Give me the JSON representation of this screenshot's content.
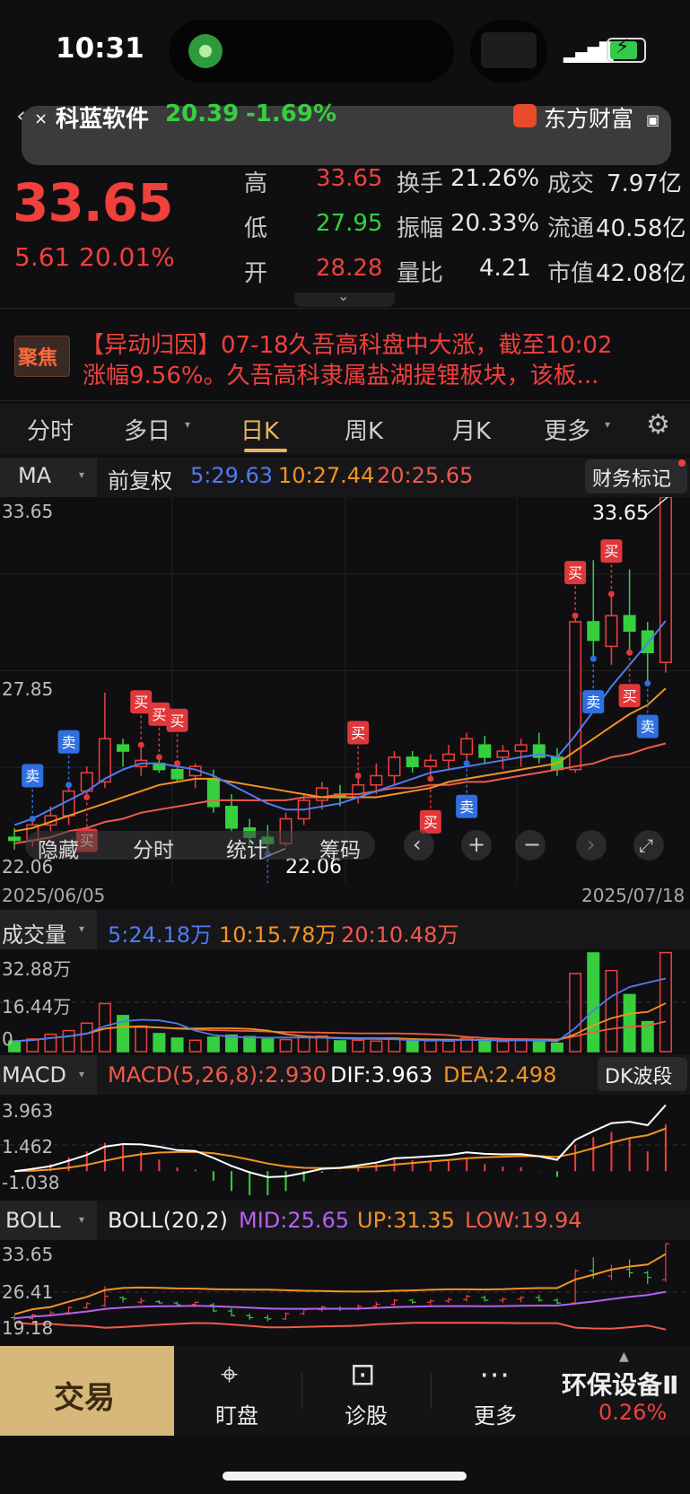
{
  "status_bar": {
    "time": "10:31"
  },
  "banner": {
    "close": "×",
    "name": "科蓝软件",
    "price": "20.39",
    "change": "-1.69%",
    "brand": "东方财富"
  },
  "quote": {
    "price": "33.65",
    "change": "5.61",
    "change_pct": "20.01%",
    "high_label": "高",
    "high": "33.65",
    "low_label": "低",
    "low": "27.95",
    "open_label": "开",
    "open": "28.28",
    "turnover_label": "换手",
    "turnover": "21.26%",
    "amplitude_label": "振幅",
    "amplitude": "20.33%",
    "vol_ratio_label": "量比",
    "vol_ratio": "4.21",
    "amount_label": "成交",
    "amount": "7.97亿",
    "float_label": "流通",
    "float_cap": "40.58亿",
    "mcap_label": "市值",
    "mcap": "42.08亿"
  },
  "focus": {
    "badge": "聚焦",
    "line1": "【异动归因】07-18久吾高科盘中大涨，截至10:02",
    "line2": "涨幅9.56%。久吾高科隶属盐湖提锂板块，该板..."
  },
  "tabs": [
    {
      "label": "分时"
    },
    {
      "label": "多日"
    },
    {
      "label": "日K"
    },
    {
      "label": "周K"
    },
    {
      "label": "月K"
    },
    {
      "label": "更多"
    }
  ],
  "indicator_row": {
    "ma_chip": "MA",
    "adjust": "前复权",
    "ma5": "5:29.63",
    "ma10": "10:27.44",
    "ma20": "20:25.65",
    "finance_btn": "财务标记"
  },
  "kline": {
    "y_top": "33.65",
    "y_mid": "27.85",
    "y_bot": "22.06",
    "max_label": "33.65",
    "min_label": "22.06",
    "date_start": "2025/06/05",
    "date_end": "2025/07/18",
    "signals": {
      "buy": "买",
      "sell": "卖"
    }
  },
  "chart_toolbar": {
    "hide": "隐藏",
    "intraday": "分时",
    "stats": "统计",
    "chips": "筹码"
  },
  "volume_panel": {
    "chip": "成交量",
    "v5": "5:24.18万",
    "v10": "10:15.78万",
    "v20": "20:10.48万",
    "y_top": "32.88万",
    "y_mid": "16.44万",
    "y_bot": "0"
  },
  "macd_panel": {
    "chip": "MACD",
    "macd": "MACD(5,26,8):2.930",
    "dif": "DIF:3.963",
    "dea": "DEA:2.498",
    "btn": "DK波段",
    "y_top": "3.963",
    "y_mid": "1.462",
    "y_bot": "-1.038"
  },
  "boll_panel": {
    "chip": "BOLL",
    "boll": "BOLL(20,2)",
    "mid": "MID:25.65",
    "up": "UP:31.35",
    "low": "LOW:19.94",
    "y_top": "33.65",
    "y_mid": "26.41",
    "y_bot": "19.18"
  },
  "bottom_nav": {
    "trade": "交易",
    "watch": "盯盘",
    "diagnose": "诊股",
    "more": "更多",
    "sector": "环保设备Ⅱ",
    "sector_change": "0.26%"
  },
  "colors": {
    "up": "#f0403c",
    "down": "#36d03e",
    "accent": "#e8b659",
    "ma5": "#4f7cf0",
    "ma10": "#f39322",
    "ma20": "#f05a4a"
  },
  "chart_data": {
    "type": "candlestick",
    "candles": [
      {
        "o": 22.6,
        "h": 22.9,
        "l": 22.2,
        "c": 22.5
      },
      {
        "o": 22.5,
        "h": 23.2,
        "l": 22.3,
        "c": 23.0
      },
      {
        "o": 23.0,
        "h": 23.6,
        "l": 22.8,
        "c": 23.3
      },
      {
        "o": 23.3,
        "h": 24.3,
        "l": 23.0,
        "c": 24.1
      },
      {
        "o": 24.1,
        "h": 24.9,
        "l": 23.9,
        "c": 24.7
      },
      {
        "o": 24.4,
        "h": 27.3,
        "l": 24.2,
        "c": 25.8
      },
      {
        "o": 25.6,
        "h": 25.8,
        "l": 24.9,
        "c": 25.4
      },
      {
        "o": 24.9,
        "h": 25.6,
        "l": 24.6,
        "c": 25.1
      },
      {
        "o": 25.0,
        "h": 25.2,
        "l": 24.7,
        "c": 24.8
      },
      {
        "o": 24.8,
        "h": 25.0,
        "l": 24.4,
        "c": 24.5
      },
      {
        "o": 24.6,
        "h": 25.0,
        "l": 24.2,
        "c": 24.9
      },
      {
        "o": 24.5,
        "h": 24.8,
        "l": 23.4,
        "c": 23.6
      },
      {
        "o": 23.6,
        "h": 24.0,
        "l": 22.8,
        "c": 22.9
      },
      {
        "o": 22.9,
        "h": 23.2,
        "l": 22.3,
        "c": 22.6
      },
      {
        "o": 22.6,
        "h": 23.0,
        "l": 22.06,
        "c": 22.4
      },
      {
        "o": 22.4,
        "h": 23.4,
        "l": 22.3,
        "c": 23.2
      },
      {
        "o": 23.2,
        "h": 24.0,
        "l": 23.0,
        "c": 23.8
      },
      {
        "o": 23.8,
        "h": 24.4,
        "l": 23.5,
        "c": 24.2
      },
      {
        "o": 24.0,
        "h": 24.3,
        "l": 23.6,
        "c": 23.9
      },
      {
        "o": 23.9,
        "h": 24.6,
        "l": 23.7,
        "c": 24.3
      },
      {
        "o": 24.3,
        "h": 25.0,
        "l": 24.0,
        "c": 24.6
      },
      {
        "o": 24.6,
        "h": 25.4,
        "l": 24.3,
        "c": 25.2
      },
      {
        "o": 25.2,
        "h": 25.4,
        "l": 24.7,
        "c": 24.9
      },
      {
        "o": 24.9,
        "h": 25.3,
        "l": 24.5,
        "c": 25.1
      },
      {
        "o": 25.1,
        "h": 25.6,
        "l": 24.8,
        "c": 25.3
      },
      {
        "o": 25.3,
        "h": 26.0,
        "l": 25.0,
        "c": 25.8
      },
      {
        "o": 25.6,
        "h": 25.9,
        "l": 25.0,
        "c": 25.2
      },
      {
        "o": 25.2,
        "h": 25.6,
        "l": 24.8,
        "c": 25.4
      },
      {
        "o": 25.4,
        "h": 25.8,
        "l": 24.9,
        "c": 25.6
      },
      {
        "o": 25.6,
        "h": 26.0,
        "l": 25.0,
        "c": 25.2
      },
      {
        "o": 25.2,
        "h": 25.5,
        "l": 24.6,
        "c": 24.8
      },
      {
        "o": 24.8,
        "h": 29.8,
        "l": 24.7,
        "c": 29.6
      },
      {
        "o": 29.6,
        "h": 31.6,
        "l": 28.4,
        "c": 29.0
      },
      {
        "o": 28.8,
        "h": 30.5,
        "l": 28.2,
        "c": 29.8
      },
      {
        "o": 29.8,
        "h": 31.3,
        "l": 28.6,
        "c": 29.3
      },
      {
        "o": 29.3,
        "h": 29.6,
        "l": 27.6,
        "c": 28.6
      },
      {
        "o": 28.28,
        "h": 33.65,
        "l": 27.95,
        "c": 33.65
      }
    ],
    "ma5": [
      23.0,
      23.2,
      23.5,
      23.8,
      24.1,
      24.5,
      24.8,
      25.0,
      25.0,
      24.9,
      24.8,
      24.6,
      24.3,
      24.0,
      23.7,
      23.5,
      23.5,
      23.6,
      23.7,
      23.9,
      24.1,
      24.3,
      24.5,
      24.7,
      24.8,
      24.9,
      25.0,
      25.1,
      25.2,
      25.3,
      25.2,
      25.9,
      26.7,
      27.5,
      28.2,
      28.9,
      29.63
    ],
    "ma10": [
      22.8,
      22.9,
      23.1,
      23.3,
      23.5,
      23.7,
      23.9,
      24.1,
      24.3,
      24.4,
      24.5,
      24.5,
      24.4,
      24.3,
      24.2,
      24.1,
      24.0,
      23.9,
      23.9,
      23.9,
      23.9,
      24.0,
      24.1,
      24.2,
      24.4,
      24.5,
      24.6,
      24.7,
      24.8,
      24.9,
      25.0,
      25.4,
      25.8,
      26.2,
      26.6,
      26.9,
      27.44
    ],
    "ma20": [
      22.4,
      22.5,
      22.6,
      22.8,
      22.9,
      23.1,
      23.2,
      23.4,
      23.5,
      23.6,
      23.7,
      23.8,
      23.8,
      23.8,
      23.8,
      23.8,
      23.9,
      23.9,
      24.0,
      24.0,
      24.1,
      24.2,
      24.2,
      24.3,
      24.3,
      24.4,
      24.4,
      24.5,
      24.6,
      24.7,
      24.8,
      24.9,
      25.0,
      25.2,
      25.3,
      25.5,
      25.65
    ],
    "volume": [
      3.5,
      4.2,
      5.8,
      7.0,
      9.5,
      16.0,
      12.0,
      8.5,
      6.0,
      4.5,
      3.8,
      4.8,
      5.5,
      5.0,
      4.2,
      4.0,
      4.8,
      5.2,
      3.6,
      3.8,
      3.5,
      4.5,
      3.4,
      3.6,
      3.5,
      4.6,
      3.8,
      3.4,
      3.9,
      3.2,
      2.8,
      26.0,
      32.88,
      27.0,
      19.0,
      10.0,
      33.0
    ],
    "vol_ylim": [
      0,
      32.88
    ],
    "y_range": [
      22.06,
      33.65
    ],
    "x_range": [
      "2025/06/05",
      "2025/07/18"
    ],
    "macd_ylim": [
      -1.038,
      3.963
    ],
    "boll_ylim": [
      19.18,
      33.65
    ],
    "boll_mid": 25.65,
    "boll_up": 31.35,
    "boll_low": 19.94
  }
}
